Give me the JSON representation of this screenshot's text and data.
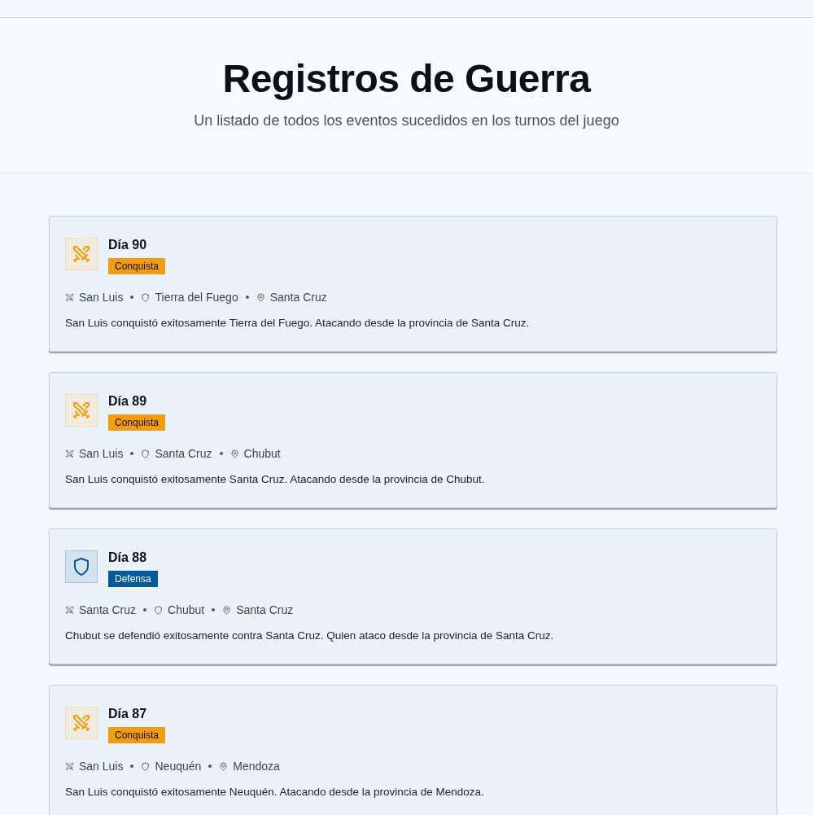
{
  "header": {
    "title": "Registros de Guerra",
    "subtitle": "Un listado de todos los eventos sucedidos en los turnos del juego"
  },
  "events": [
    {
      "kind": "conquista",
      "day": "Día 90",
      "badge": "Conquista",
      "attacker": "San Luis",
      "defender": "Tierra del Fuego",
      "origin": "Santa Cruz",
      "description": "San Luis conquistó exitosamente Tierra del Fuego. Atacando desde la provincia de Santa Cruz."
    },
    {
      "kind": "conquista",
      "day": "Día 89",
      "badge": "Conquista",
      "attacker": "San Luis",
      "defender": "Santa Cruz",
      "origin": "Chubut",
      "description": "San Luis conquistó exitosamente Santa Cruz. Atacando desde la provincia de Chubut."
    },
    {
      "kind": "defensa",
      "day": "Día 88",
      "badge": "Defensa",
      "attacker": "Santa Cruz",
      "defender": "Chubut",
      "origin": "Santa Cruz",
      "description": "Chubut se defendió exitosamente contra Santa Cruz. Quien ataco desde la provincia de Santa Cruz."
    },
    {
      "kind": "conquista",
      "day": "Día 87",
      "badge": "Conquista",
      "attacker": "San Luis",
      "defender": "Neuquén",
      "origin": "Mendoza",
      "description": "San Luis conquistó exitosamente Neuquén. Atacando desde la provincia de Mendoza."
    }
  ]
}
